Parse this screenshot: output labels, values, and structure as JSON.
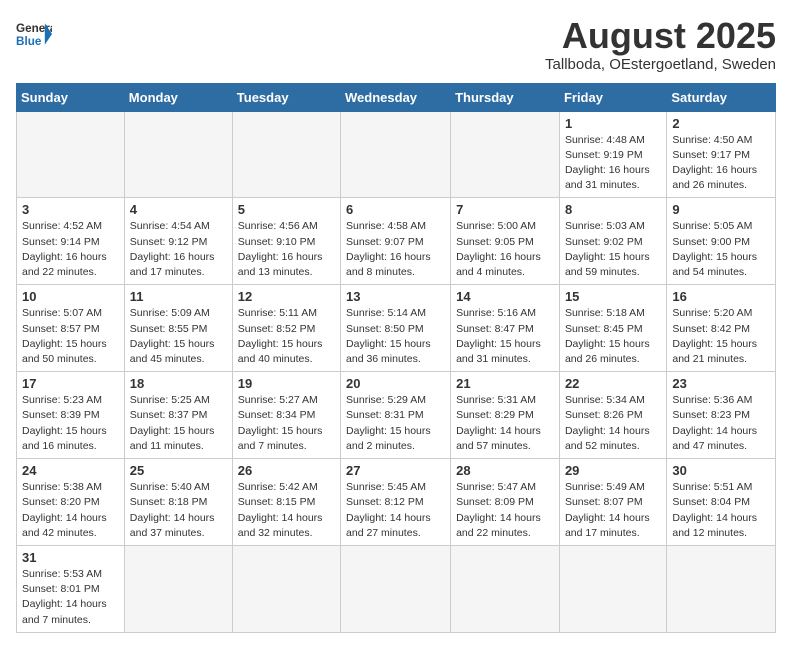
{
  "logo": {
    "text_general": "General",
    "text_blue": "Blue"
  },
  "title": "August 2025",
  "subtitle": "Tallboda, OEstergoetland, Sweden",
  "weekdays": [
    "Sunday",
    "Monday",
    "Tuesday",
    "Wednesday",
    "Thursday",
    "Friday",
    "Saturday"
  ],
  "weeks": [
    [
      {
        "day": "",
        "info": ""
      },
      {
        "day": "",
        "info": ""
      },
      {
        "day": "",
        "info": ""
      },
      {
        "day": "",
        "info": ""
      },
      {
        "day": "",
        "info": ""
      },
      {
        "day": "1",
        "info": "Sunrise: 4:48 AM\nSunset: 9:19 PM\nDaylight: 16 hours and 31 minutes."
      },
      {
        "day": "2",
        "info": "Sunrise: 4:50 AM\nSunset: 9:17 PM\nDaylight: 16 hours and 26 minutes."
      }
    ],
    [
      {
        "day": "3",
        "info": "Sunrise: 4:52 AM\nSunset: 9:14 PM\nDaylight: 16 hours and 22 minutes."
      },
      {
        "day": "4",
        "info": "Sunrise: 4:54 AM\nSunset: 9:12 PM\nDaylight: 16 hours and 17 minutes."
      },
      {
        "day": "5",
        "info": "Sunrise: 4:56 AM\nSunset: 9:10 PM\nDaylight: 16 hours and 13 minutes."
      },
      {
        "day": "6",
        "info": "Sunrise: 4:58 AM\nSunset: 9:07 PM\nDaylight: 16 hours and 8 minutes."
      },
      {
        "day": "7",
        "info": "Sunrise: 5:00 AM\nSunset: 9:05 PM\nDaylight: 16 hours and 4 minutes."
      },
      {
        "day": "8",
        "info": "Sunrise: 5:03 AM\nSunset: 9:02 PM\nDaylight: 15 hours and 59 minutes."
      },
      {
        "day": "9",
        "info": "Sunrise: 5:05 AM\nSunset: 9:00 PM\nDaylight: 15 hours and 54 minutes."
      }
    ],
    [
      {
        "day": "10",
        "info": "Sunrise: 5:07 AM\nSunset: 8:57 PM\nDaylight: 15 hours and 50 minutes."
      },
      {
        "day": "11",
        "info": "Sunrise: 5:09 AM\nSunset: 8:55 PM\nDaylight: 15 hours and 45 minutes."
      },
      {
        "day": "12",
        "info": "Sunrise: 5:11 AM\nSunset: 8:52 PM\nDaylight: 15 hours and 40 minutes."
      },
      {
        "day": "13",
        "info": "Sunrise: 5:14 AM\nSunset: 8:50 PM\nDaylight: 15 hours and 36 minutes."
      },
      {
        "day": "14",
        "info": "Sunrise: 5:16 AM\nSunset: 8:47 PM\nDaylight: 15 hours and 31 minutes."
      },
      {
        "day": "15",
        "info": "Sunrise: 5:18 AM\nSunset: 8:45 PM\nDaylight: 15 hours and 26 minutes."
      },
      {
        "day": "16",
        "info": "Sunrise: 5:20 AM\nSunset: 8:42 PM\nDaylight: 15 hours and 21 minutes."
      }
    ],
    [
      {
        "day": "17",
        "info": "Sunrise: 5:23 AM\nSunset: 8:39 PM\nDaylight: 15 hours and 16 minutes."
      },
      {
        "day": "18",
        "info": "Sunrise: 5:25 AM\nSunset: 8:37 PM\nDaylight: 15 hours and 11 minutes."
      },
      {
        "day": "19",
        "info": "Sunrise: 5:27 AM\nSunset: 8:34 PM\nDaylight: 15 hours and 7 minutes."
      },
      {
        "day": "20",
        "info": "Sunrise: 5:29 AM\nSunset: 8:31 PM\nDaylight: 15 hours and 2 minutes."
      },
      {
        "day": "21",
        "info": "Sunrise: 5:31 AM\nSunset: 8:29 PM\nDaylight: 14 hours and 57 minutes."
      },
      {
        "day": "22",
        "info": "Sunrise: 5:34 AM\nSunset: 8:26 PM\nDaylight: 14 hours and 52 minutes."
      },
      {
        "day": "23",
        "info": "Sunrise: 5:36 AM\nSunset: 8:23 PM\nDaylight: 14 hours and 47 minutes."
      }
    ],
    [
      {
        "day": "24",
        "info": "Sunrise: 5:38 AM\nSunset: 8:20 PM\nDaylight: 14 hours and 42 minutes."
      },
      {
        "day": "25",
        "info": "Sunrise: 5:40 AM\nSunset: 8:18 PM\nDaylight: 14 hours and 37 minutes."
      },
      {
        "day": "26",
        "info": "Sunrise: 5:42 AM\nSunset: 8:15 PM\nDaylight: 14 hours and 32 minutes."
      },
      {
        "day": "27",
        "info": "Sunrise: 5:45 AM\nSunset: 8:12 PM\nDaylight: 14 hours and 27 minutes."
      },
      {
        "day": "28",
        "info": "Sunrise: 5:47 AM\nSunset: 8:09 PM\nDaylight: 14 hours and 22 minutes."
      },
      {
        "day": "29",
        "info": "Sunrise: 5:49 AM\nSunset: 8:07 PM\nDaylight: 14 hours and 17 minutes."
      },
      {
        "day": "30",
        "info": "Sunrise: 5:51 AM\nSunset: 8:04 PM\nDaylight: 14 hours and 12 minutes."
      }
    ],
    [
      {
        "day": "31",
        "info": "Sunrise: 5:53 AM\nSunset: 8:01 PM\nDaylight: 14 hours and 7 minutes."
      },
      {
        "day": "",
        "info": ""
      },
      {
        "day": "",
        "info": ""
      },
      {
        "day": "",
        "info": ""
      },
      {
        "day": "",
        "info": ""
      },
      {
        "day": "",
        "info": ""
      },
      {
        "day": "",
        "info": ""
      }
    ]
  ]
}
